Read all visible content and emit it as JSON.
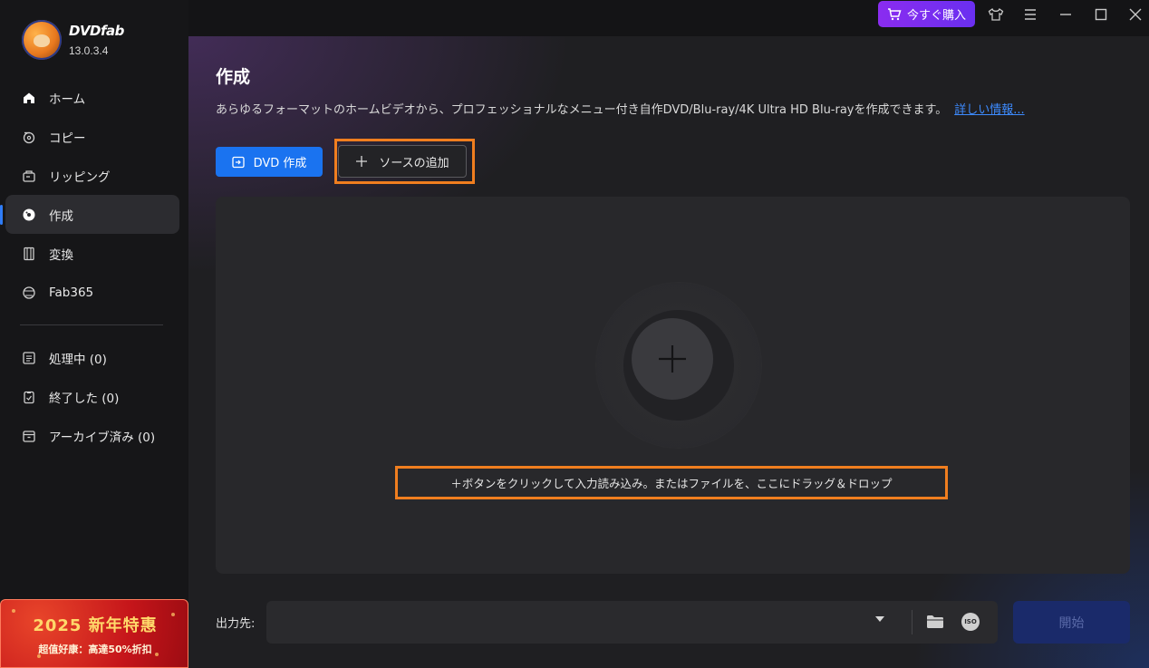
{
  "app": {
    "name": "DVDfab",
    "version": "13.0.3.4",
    "accent": "#1a73f0",
    "highlight": "#f07e1f"
  },
  "sidebar": {
    "items": [
      {
        "label": "ホーム",
        "icon": "home-icon"
      },
      {
        "label": "コピー",
        "icon": "copy-icon"
      },
      {
        "label": "リッピング",
        "icon": "ripping-icon"
      },
      {
        "label": "作成",
        "icon": "disc-icon",
        "active": true
      },
      {
        "label": "変換",
        "icon": "film-icon"
      },
      {
        "label": "Fab365",
        "icon": "fab365-icon"
      }
    ],
    "tasks": [
      {
        "label": "処理中 (0)",
        "icon": "processing-icon"
      },
      {
        "label": "終了した (0)",
        "icon": "finished-icon"
      },
      {
        "label": "アーカイブ済み (0)",
        "icon": "archive-icon"
      }
    ],
    "promo": {
      "title": "2025 新年特惠",
      "subtitle": "超值好康：高達50%折扣"
    }
  },
  "titlebar": {
    "buy_label": "今すぐ購入"
  },
  "main": {
    "title": "作成",
    "description": "あらゆるフォーマットのホームビデオから、プロフェッショナルなメニュー付き自作DVD/Blu-ray/4K Ultra HD Blu-rayを作成できます。",
    "more_link": "詳しい情報...",
    "create_button": "DVD 作成",
    "add_source_button": "ソースの追加",
    "drop_hint": "＋ボタンをクリックして入力読み込み。またはファイルを、ここにドラッグ＆ドロップ",
    "output_label": "出力先:",
    "output_value": "",
    "start_button": "開始"
  }
}
